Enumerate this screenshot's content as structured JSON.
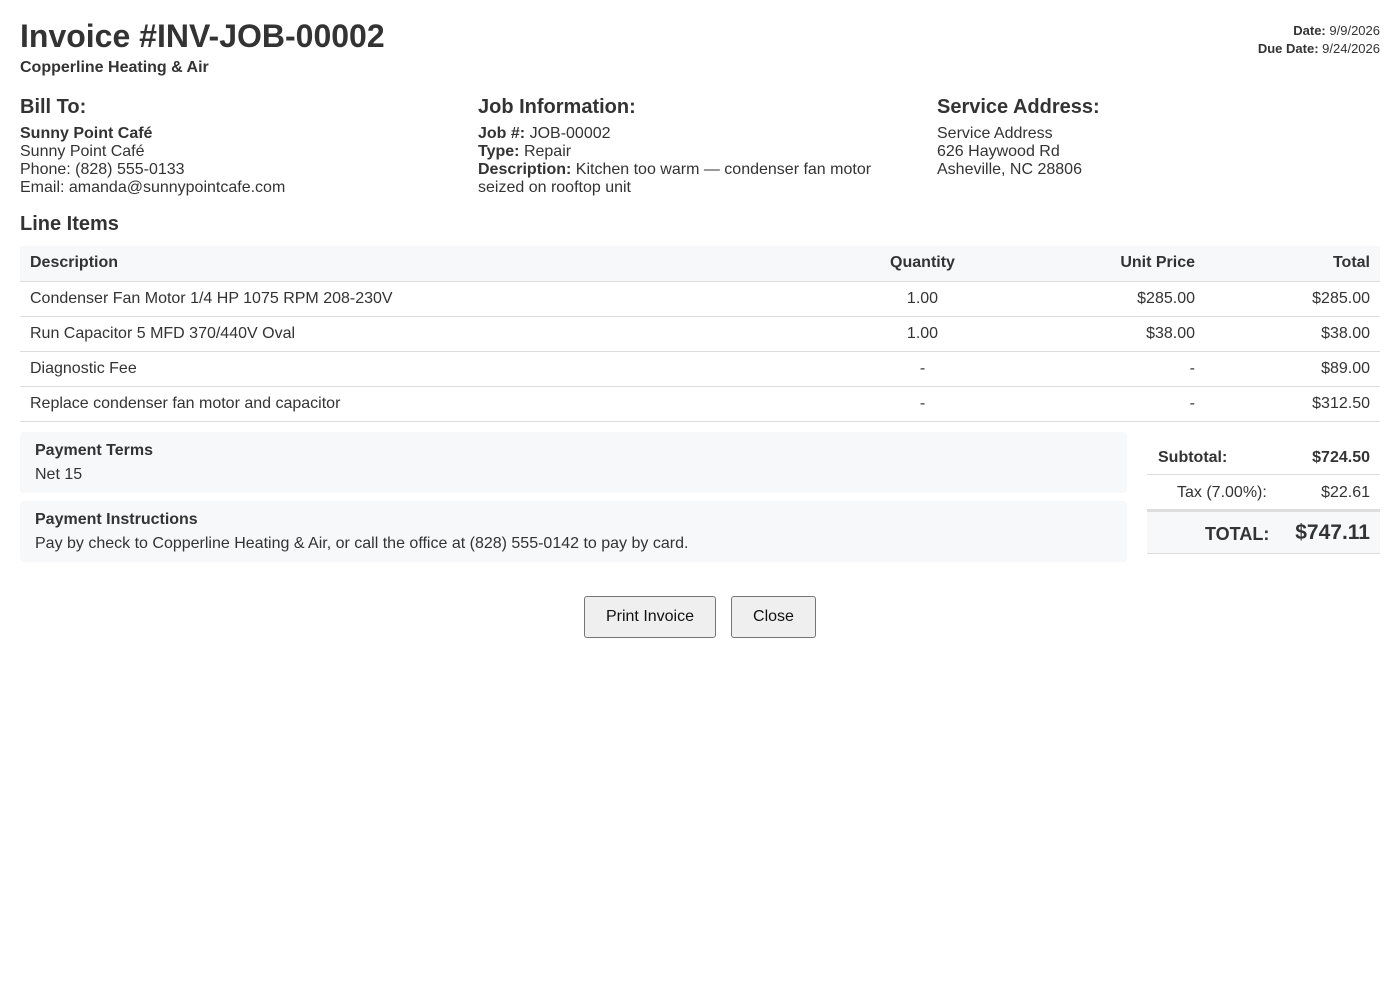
{
  "header": {
    "title": "Invoice #INV-JOB-00002",
    "company": "Copperline Heating & Air",
    "date_label": "Date:",
    "date": "9/9/2026",
    "due_label": "Due Date:",
    "due_date": "9/24/2026"
  },
  "bill_to": {
    "heading": "Bill To:",
    "name": "Sunny Point Café",
    "company": "Sunny Point Café",
    "phone": "Phone: (828) 555-0133",
    "email": "Email: amanda@sunnypointcafe.com"
  },
  "job_info": {
    "heading": "Job Information:",
    "job_label": "Job #:",
    "job_number": "JOB-00002",
    "type_label": "Type:",
    "type": "Repair",
    "desc_label": "Description:",
    "description": "Kitchen too warm — condenser fan motor seized on rooftop unit"
  },
  "service_address": {
    "heading": "Service Address:",
    "line1": "Service Address",
    "line2": "626 Haywood Rd",
    "line3": "Asheville, NC 28806"
  },
  "line_items": {
    "heading": "Line Items",
    "columns": {
      "description": "Description",
      "quantity": "Quantity",
      "unit_price": "Unit Price",
      "total": "Total"
    },
    "rows": [
      {
        "description": "Condenser Fan Motor 1/4 HP 1075 RPM 208-230V",
        "quantity": "1.00",
        "unit_price": "$285.00",
        "total": "$285.00"
      },
      {
        "description": "Run Capacitor 5 MFD 370/440V Oval",
        "quantity": "1.00",
        "unit_price": "$38.00",
        "total": "$38.00"
      },
      {
        "description": "Diagnostic Fee",
        "quantity": "-",
        "unit_price": "-",
        "total": "$89.00"
      },
      {
        "description": "Replace condenser fan motor and capacitor",
        "quantity": "-",
        "unit_price": "-",
        "total": "$312.50"
      }
    ]
  },
  "payment_terms": {
    "title": "Payment Terms",
    "text": "Net 15"
  },
  "payment_instructions": {
    "title": "Payment Instructions",
    "text": "Pay by check to Copperline Heating & Air, or call the office at (828) 555-0142 to pay by card."
  },
  "totals": {
    "subtotal_label": "Subtotal:",
    "subtotal": "$724.50",
    "tax_label": "Tax (7.00%):",
    "tax": "$22.61",
    "total_label": "TOTAL:",
    "total": "$747.11"
  },
  "actions": {
    "print_label": "Print Invoice",
    "close_label": "Close"
  }
}
